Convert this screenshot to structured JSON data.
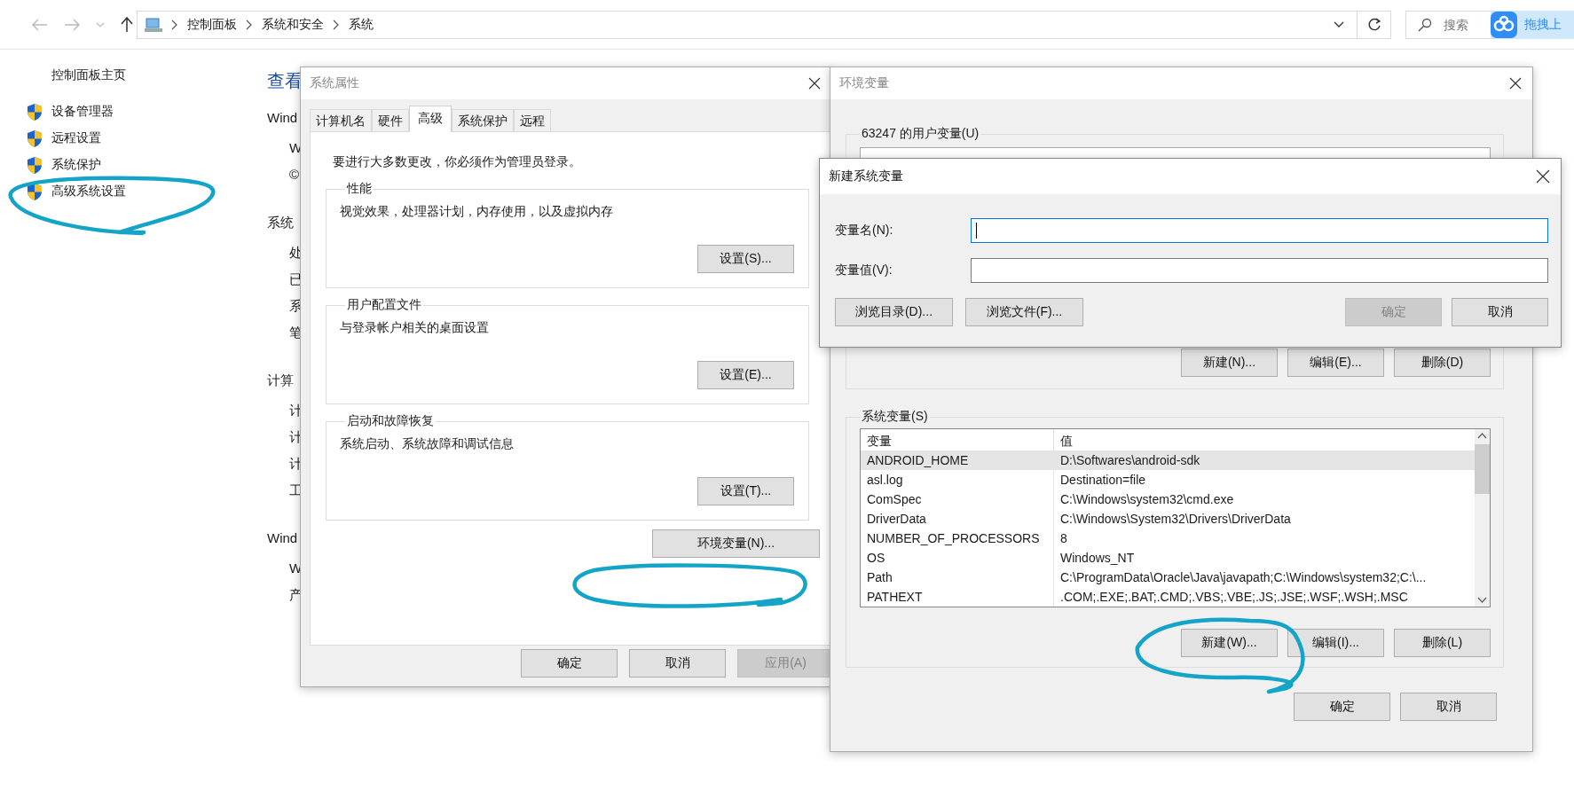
{
  "explorer": {
    "breadcrumb": [
      "控制面板",
      "系统和安全",
      "系统"
    ],
    "search": {
      "placeholder": "搜索"
    },
    "overlay_badge": {
      "label": "拖拽上"
    },
    "sidebar": {
      "home": "控制面板主页",
      "items": [
        {
          "label": "设备管理器"
        },
        {
          "label": "远程设置"
        },
        {
          "label": "系统保护"
        },
        {
          "label": "高级系统设置"
        }
      ]
    },
    "content": {
      "heading": "查看",
      "lines": [
        {
          "kind": "section",
          "text": "Wind"
        },
        {
          "kind": "item",
          "text": "W"
        },
        {
          "kind": "item",
          "text": "©"
        },
        {
          "kind": "section",
          "text": "系统"
        },
        {
          "kind": "item",
          "text": "处"
        },
        {
          "kind": "item",
          "text": "已"
        },
        {
          "kind": "item",
          "text": "系"
        },
        {
          "kind": "item",
          "text": "笔"
        },
        {
          "kind": "section",
          "text": "计算"
        },
        {
          "kind": "item",
          "text": "计"
        },
        {
          "kind": "item",
          "text": "计"
        },
        {
          "kind": "item",
          "text": "计"
        },
        {
          "kind": "item",
          "text": "工"
        },
        {
          "kind": "section",
          "text": "Wind"
        },
        {
          "kind": "item",
          "text": "W"
        },
        {
          "kind": "item",
          "text": "产"
        }
      ]
    }
  },
  "system_properties": {
    "title": "系统属性",
    "tabs": [
      {
        "label": "计算机名",
        "selected": false
      },
      {
        "label": "硬件",
        "selected": false
      },
      {
        "label": "高级",
        "selected": true
      },
      {
        "label": "系统保护",
        "selected": false
      },
      {
        "label": "远程",
        "selected": false
      }
    ],
    "notice": "要进行大多数更改，你必须作为管理员登录。",
    "groups": [
      {
        "title": "性能",
        "description": "视觉效果，处理器计划，内存使用，以及虚拟内存",
        "button": "设置(S)..."
      },
      {
        "title": "用户配置文件",
        "description": "与登录帐户相关的桌面设置",
        "button": "设置(E)..."
      },
      {
        "title": "启动和故障恢复",
        "description": "系统启动、系统故障和调试信息",
        "button": "设置(T)..."
      }
    ],
    "env_button": "环境变量(N)...",
    "buttons": [
      {
        "label": "确定",
        "disabled": false
      },
      {
        "label": "取消",
        "disabled": false
      },
      {
        "label": "应用(A)",
        "disabled": true
      }
    ]
  },
  "environment_variables": {
    "title": "环境变量",
    "user_group": "63247 的用户变量(U)",
    "user_buttons": [
      {
        "label": "新建(N)...",
        "disabled": false
      },
      {
        "label": "编辑(E)...",
        "disabled": false
      },
      {
        "label": "删除(D)",
        "disabled": false
      }
    ],
    "system_group": "系统变量(S)",
    "columns": [
      "变量",
      "值"
    ],
    "rows": [
      {
        "name": "ANDROID_HOME",
        "value": "D:\\Softwares\\android-sdk",
        "selected": true
      },
      {
        "name": "asl.log",
        "value": "Destination=file",
        "selected": false
      },
      {
        "name": "ComSpec",
        "value": "C:\\Windows\\system32\\cmd.exe",
        "selected": false
      },
      {
        "name": "DriverData",
        "value": "C:\\Windows\\System32\\Drivers\\DriverData",
        "selected": false
      },
      {
        "name": "NUMBER_OF_PROCESSORS",
        "value": "8",
        "selected": false
      },
      {
        "name": "OS",
        "value": "Windows_NT",
        "selected": false
      },
      {
        "name": "Path",
        "value": "C:\\ProgramData\\Oracle\\Java\\javapath;C:\\Windows\\system32;C:\\...",
        "selected": false
      },
      {
        "name": "PATHEXT",
        "value": ".COM;.EXE;.BAT;.CMD;.VBS;.VBE;.JS;.JSE;.WSF;.WSH;.MSC",
        "selected": false
      }
    ],
    "system_buttons": [
      {
        "label": "新建(W)...",
        "disabled": false
      },
      {
        "label": "编辑(I)...",
        "disabled": false
      },
      {
        "label": "删除(L)",
        "disabled": false
      }
    ],
    "buttons": [
      {
        "label": "确定",
        "disabled": false
      },
      {
        "label": "取消",
        "disabled": false
      }
    ]
  },
  "new_system_variable": {
    "title": "新建系统变量",
    "fields": [
      {
        "label": "变量名(N):",
        "focused": true
      },
      {
        "label": "变量值(V):",
        "focused": false
      }
    ],
    "browse_buttons": [
      {
        "label": "浏览目录(D)...",
        "disabled": false
      },
      {
        "label": "浏览文件(F)...",
        "disabled": false
      }
    ],
    "buttons": [
      {
        "label": "确定",
        "disabled": true
      },
      {
        "label": "取消",
        "disabled": false
      }
    ]
  }
}
